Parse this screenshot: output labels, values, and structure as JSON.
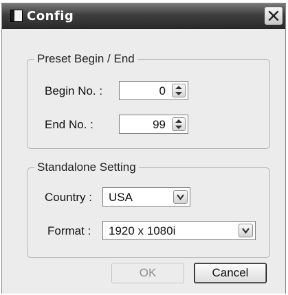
{
  "window": {
    "title": "Config"
  },
  "icons": {
    "app": "app-window-icon",
    "close": "close-icon",
    "spinner": "spinner-arrows-icon",
    "dropdown": "dropdown-arrow-icon"
  },
  "preset": {
    "group_title": "Preset Begin / End",
    "begin_label": "Begin No. :",
    "begin_value": "0",
    "end_label": "End No. :",
    "end_value": "99"
  },
  "standalone": {
    "group_title": "Standalone Setting",
    "country_label": "Country :",
    "country_value": "USA",
    "format_label": "Format :",
    "format_value": "1920 x 1080i"
  },
  "buttons": {
    "ok": "OK",
    "cancel": "Cancel"
  },
  "colors": {
    "titlebar": "#2a2a2a",
    "background": "#ececec"
  }
}
